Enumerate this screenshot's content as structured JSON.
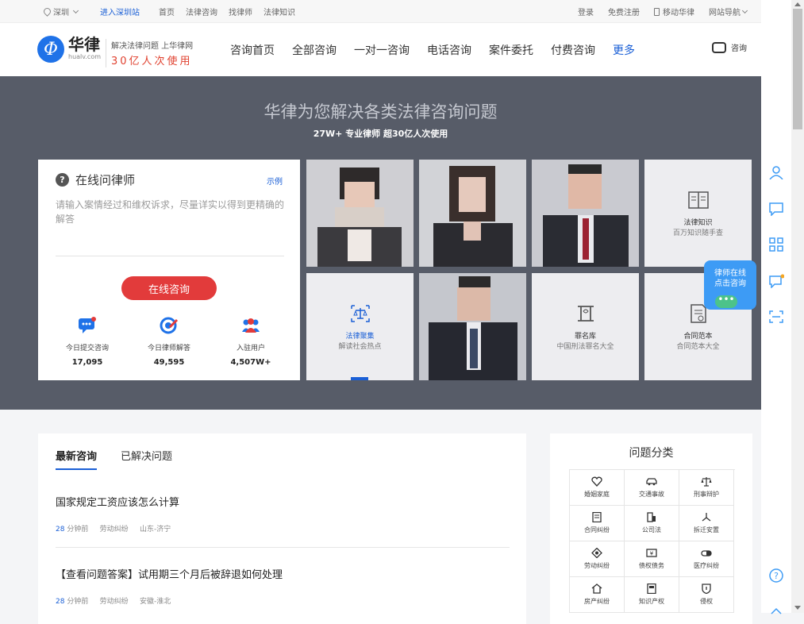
{
  "topbar": {
    "location": "深圳",
    "enter_station": "进入深圳站",
    "links": [
      "首页",
      "法律咨询",
      "找律师",
      "法律知识"
    ],
    "login": "登录",
    "register": "免费注册",
    "mobile": "移动华律",
    "site_nav": "网站导航"
  },
  "header": {
    "logo_glyph": "Φ",
    "brand_cn": "华律",
    "brand_en": "hualv.com",
    "slogan_line1": "解决法律问题 上华律网",
    "slogan_line2": "30亿人次使用",
    "nav": [
      "咨询首页",
      "全部咨询",
      "一对一咨询",
      "电话咨询",
      "案件委托",
      "付费咨询"
    ],
    "nav_more": "更多",
    "consult": "咨询"
  },
  "hero": {
    "title": "华律为您解决各类法律咨询问题",
    "subtitle": "27W+ 专业律师 超30亿人次使用"
  },
  "ask_panel": {
    "title": "在线问律师",
    "example": "示例",
    "placeholder": "请输入案情经过和维权诉求，尽量详实以得到更精确的解答",
    "button": "在线咨询",
    "stats": [
      {
        "label": "今日提交咨询",
        "value": "17,095",
        "icon": "chat-icon"
      },
      {
        "label": "今日律师解答",
        "value": "49,595",
        "icon": "answer-icon"
      },
      {
        "label": "入驻用户",
        "value": "4,507W+",
        "icon": "users-icon"
      }
    ]
  },
  "tiles": [
    {
      "title": "法律知识",
      "desc": "百万知识随手查",
      "icon": "book-icon"
    },
    {
      "title": "法律聚集",
      "desc": "解读社会热点",
      "icon": "scale-icon"
    },
    {
      "title": "罪名库",
      "desc": "中国刑法罪名大全",
      "icon": "law-icon"
    },
    {
      "title": "合同范本",
      "desc": "合同范本大全",
      "icon": "contract-icon"
    }
  ],
  "float_bubble": {
    "line1": "律师在线",
    "line2": "点击咨询",
    "dots": "•••"
  },
  "questions": {
    "tabs": [
      "最新咨询",
      "已解决问题"
    ],
    "items": [
      {
        "title": "国家规定工资应该怎么计算",
        "time_num": "28",
        "time_unit": "分钟前",
        "category": "劳动纠纷",
        "region": "山东-济宁"
      },
      {
        "title": "【查看问题答案】试用期三个月后被辞退如何处理",
        "time_num": "28",
        "time_unit": "分钟前",
        "category": "劳动纠纷",
        "region": "安徽-淮北"
      }
    ]
  },
  "categories": {
    "title": "问题分类",
    "items": [
      {
        "label": "婚姻家庭",
        "icon": "heart-icon"
      },
      {
        "label": "交通事故",
        "icon": "car-icon"
      },
      {
        "label": "刑事辩护",
        "icon": "scale-icon"
      },
      {
        "label": "合同纠纷",
        "icon": "document-icon"
      },
      {
        "label": "公司法",
        "icon": "building-icon"
      },
      {
        "label": "拆迁安置",
        "icon": "fan-icon"
      },
      {
        "label": "劳动纠纷",
        "icon": "diamond-icon"
      },
      {
        "label": "债权债务",
        "icon": "money-icon"
      },
      {
        "label": "医疗纠纷",
        "icon": "pill-icon"
      },
      {
        "label": "房产纠纷",
        "icon": "house-icon"
      },
      {
        "label": "知识产权",
        "icon": "book-icon"
      },
      {
        "label": "侵权",
        "icon": "shield-icon"
      }
    ]
  },
  "colors": {
    "accent": "#1a5fd6",
    "brand_red": "#e23b3b",
    "hero_bg": "#575c68"
  }
}
